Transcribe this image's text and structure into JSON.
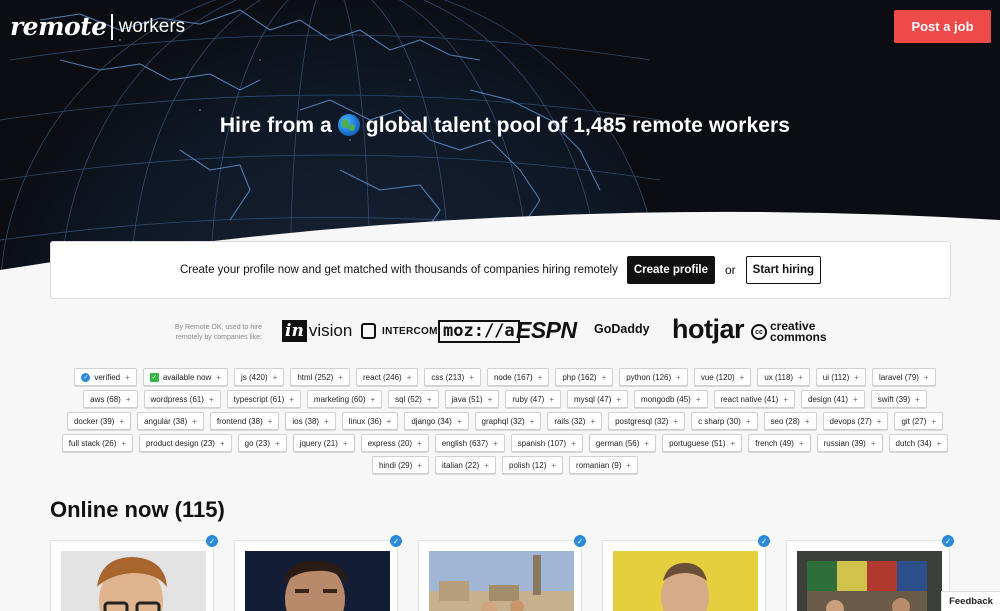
{
  "header": {
    "logo_script": "remote",
    "logo_word": "workers",
    "post_job_label": "Post a job"
  },
  "hero": {
    "title_before": "Hire from a",
    "title_after": "global talent pool of 1,485 remote workers",
    "globe_icon": "earth-globe-icon"
  },
  "cta": {
    "text": "Create your profile now and get matched with thousands of companies hiring remotely",
    "create_profile": "Create profile",
    "or": "or",
    "start_hiring": "Start hiring"
  },
  "companies": {
    "byline": "By Remote OK, used to hire remotely by companies like:",
    "invision_in": "in",
    "invision_rest": "vision",
    "intercom": "INTERCOM",
    "mozilla": "moz://a",
    "espn": "ESPN",
    "godaddy": "GoDaddy",
    "hotjar": "hotjar",
    "cc_line1": "creative",
    "cc_line2": "commons",
    "cc_mark": "cc"
  },
  "tags": [
    {
      "label": "verified",
      "icon": "verified-check-icon"
    },
    {
      "label": "available now",
      "icon": "available-check-icon"
    },
    {
      "label": "js (420)"
    },
    {
      "label": "html (252)"
    },
    {
      "label": "react (246)"
    },
    {
      "label": "css (213)"
    },
    {
      "label": "node (167)"
    },
    {
      "label": "php (162)"
    },
    {
      "label": "python (126)"
    },
    {
      "label": "vue (120)"
    },
    {
      "label": "ux (118)"
    },
    {
      "label": "ui (112)"
    },
    {
      "label": "laravel (79)"
    },
    {
      "label": "aws (68)"
    },
    {
      "label": "wordpress (61)"
    },
    {
      "label": "typescript (61)"
    },
    {
      "label": "marketing (60)"
    },
    {
      "label": "sql (52)"
    },
    {
      "label": "java (51)"
    },
    {
      "label": "ruby (47)"
    },
    {
      "label": "mysql (47)"
    },
    {
      "label": "mongodb (45)"
    },
    {
      "label": "react native (41)"
    },
    {
      "label": "design (41)"
    },
    {
      "label": "swift (39)"
    },
    {
      "label": "docker (39)"
    },
    {
      "label": "angular (38)"
    },
    {
      "label": "frontend (38)"
    },
    {
      "label": "ios (38)"
    },
    {
      "label": "linux (36)"
    },
    {
      "label": "django (34)"
    },
    {
      "label": "graphql (32)"
    },
    {
      "label": "rails (32)"
    },
    {
      "label": "postgresql (32)"
    },
    {
      "label": "c sharp (30)"
    },
    {
      "label": "seo (28)"
    },
    {
      "label": "devops (27)"
    },
    {
      "label": "git (27)"
    },
    {
      "label": "full stack (26)"
    },
    {
      "label": "product design (23)"
    },
    {
      "label": "go (23)"
    },
    {
      "label": "jquery (21)"
    },
    {
      "label": "express (20)"
    },
    {
      "label": "english (637)"
    },
    {
      "label": "spanish (107)"
    },
    {
      "label": "german (56)"
    },
    {
      "label": "portuguese (51)"
    },
    {
      "label": "french (49)"
    },
    {
      "label": "russian (39)"
    },
    {
      "label": "dutch (34)"
    },
    {
      "label": "hindi (29)"
    },
    {
      "label": "italian (22)"
    },
    {
      "label": "polish (12)"
    },
    {
      "label": "romanian (9)"
    }
  ],
  "tag_plus": "+",
  "online": {
    "title": "Online now (115)",
    "badge": "✓"
  },
  "feedback": "Feedback",
  "colors": {
    "accent_red": "#ef4a4a",
    "verified_blue": "#2a8ad8",
    "available_green": "#3ab54a",
    "hero_bg": "#0b0d12"
  }
}
